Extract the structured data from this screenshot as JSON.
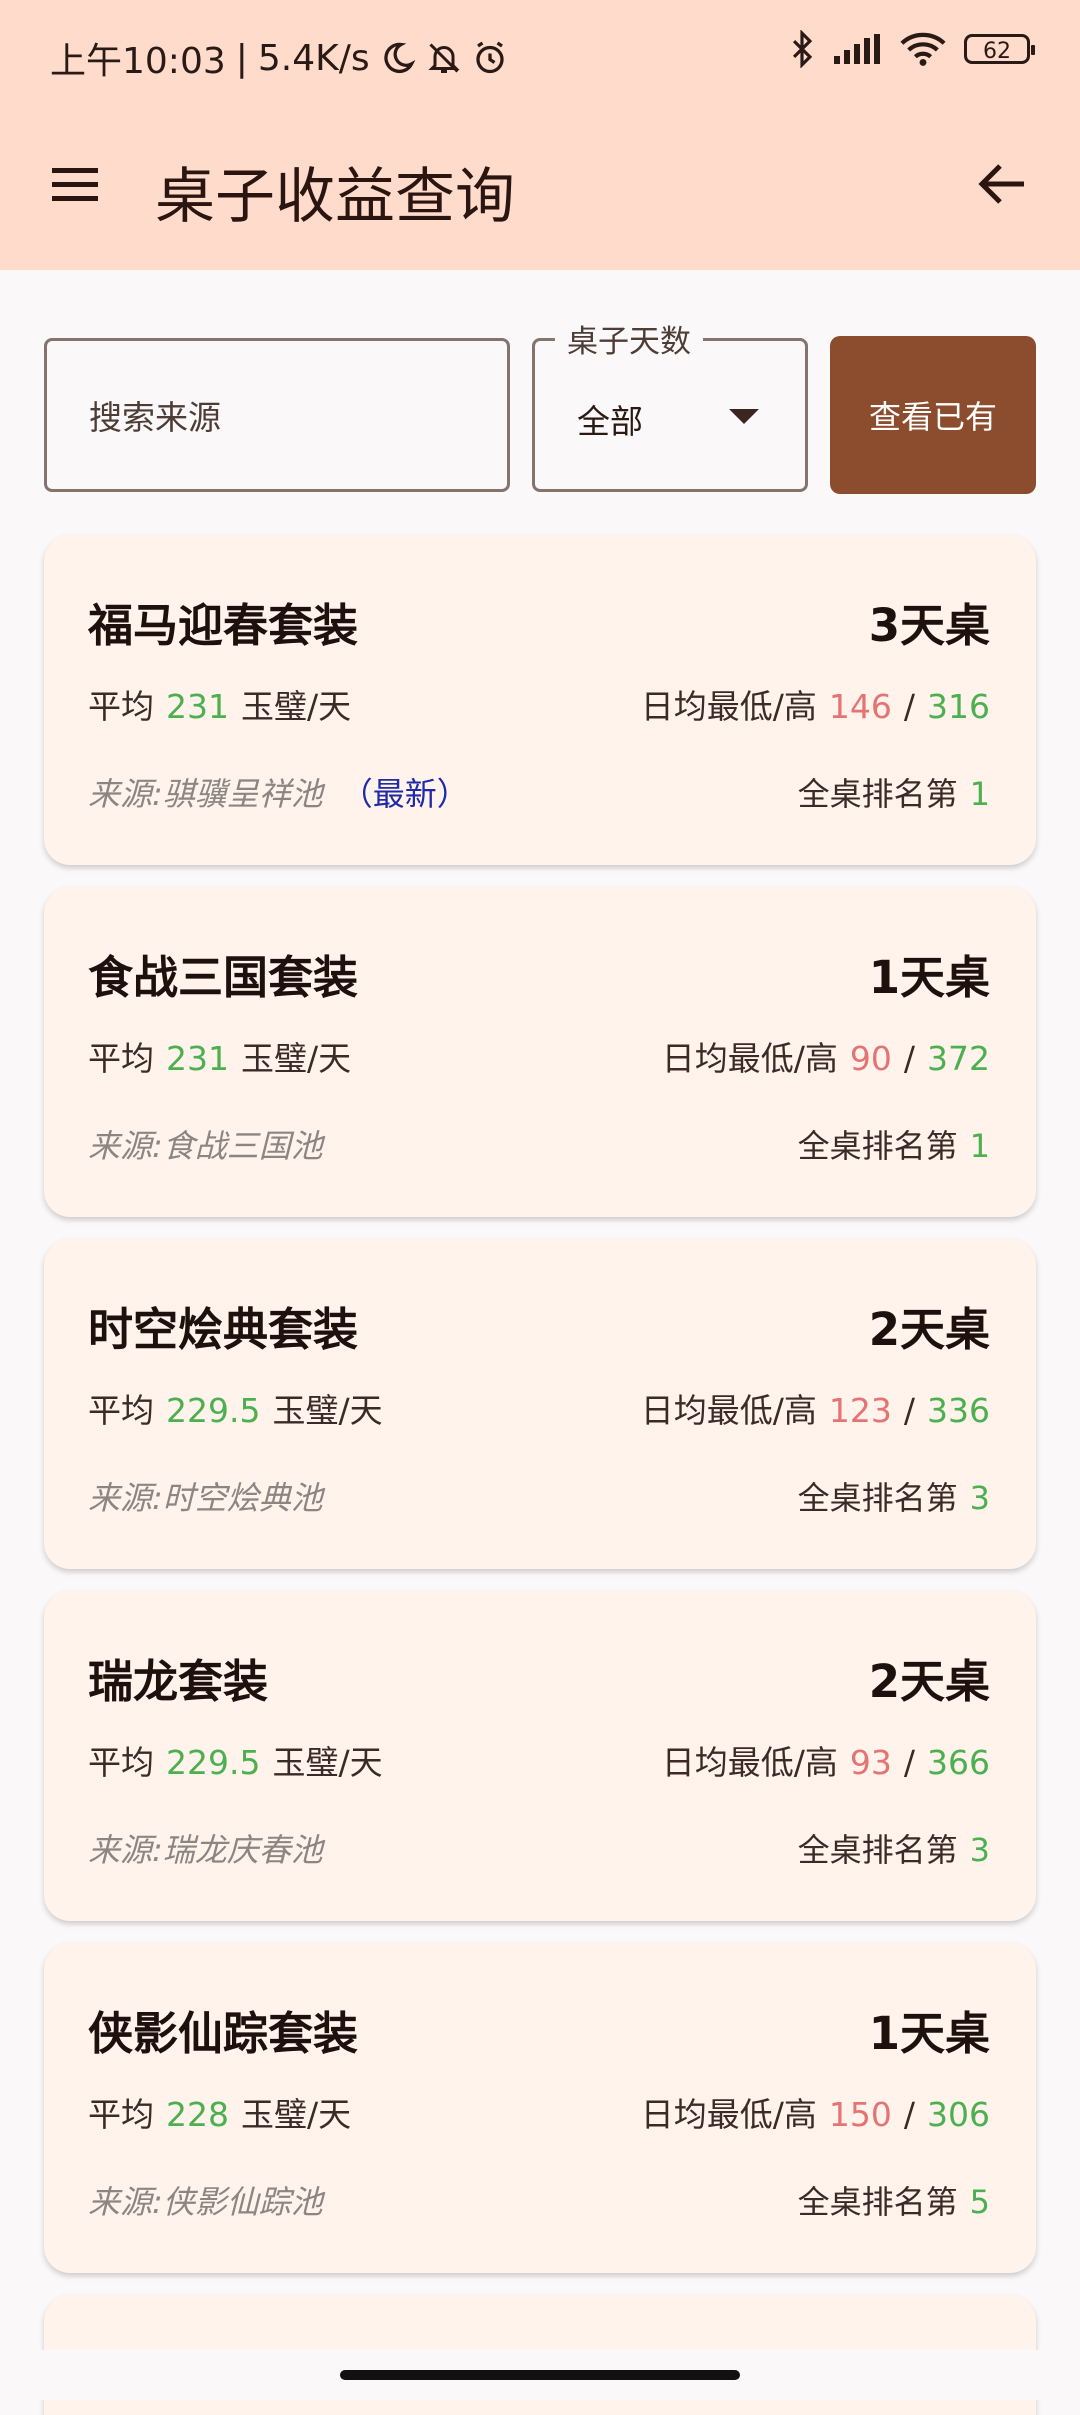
{
  "status_bar": {
    "time": "上午10:03",
    "separator": "|",
    "speed": "5.4K/s",
    "battery": "62",
    "icons": [
      "moon-icon",
      "bell-off-icon",
      "alarm-icon",
      "bluetooth-icon",
      "signal-icon",
      "wifi-icon",
      "battery-icon"
    ]
  },
  "app_bar": {
    "title": "桌子收益查询",
    "menu_icon": "hamburger-menu-icon",
    "back_icon": "arrow-back-icon"
  },
  "filters": {
    "search_placeholder": "搜索来源",
    "search_value": "",
    "days_label": "桌子天数",
    "days_value": "全部",
    "view_button": "查看已有"
  },
  "colors": {
    "header_bg": "#ffdbcc",
    "card_bg": "#fff3ec",
    "button_bg": "#8b4d2d",
    "green": "#4caf50",
    "red": "#e57373",
    "latest_blue": "#1f2aa8"
  },
  "labels": {
    "avg_prefix": "平均",
    "avg_unit": "玉璧/天",
    "minmax_label": "日均最低/高",
    "slash": "/",
    "rank_prefix": "全桌排名第"
  },
  "cards": [
    {
      "name": "福马迎春套装",
      "days": "3天桌",
      "avg": "231",
      "min": "146",
      "max": "316",
      "source": "来源:骐骥呈祥池",
      "latest": "（最新）",
      "rank": "1"
    },
    {
      "name": "食战三国套装",
      "days": "1天桌",
      "avg": "231",
      "min": "90",
      "max": "372",
      "source": "来源:食战三国池",
      "latest": "",
      "rank": "1"
    },
    {
      "name": "时空烩典套装",
      "days": "2天桌",
      "avg": "229.5",
      "min": "123",
      "max": "336",
      "source": "来源:时空烩典池",
      "latest": "",
      "rank": "3"
    },
    {
      "name": "瑞龙套装",
      "days": "2天桌",
      "avg": "229.5",
      "min": "93",
      "max": "366",
      "source": "来源:瑞龙庆春池",
      "latest": "",
      "rank": "3"
    },
    {
      "name": "侠影仙踪套装",
      "days": "1天桌",
      "avg": "228",
      "min": "150",
      "max": "306",
      "source": "来源:侠影仙踪池",
      "latest": "",
      "rank": "5"
    }
  ]
}
